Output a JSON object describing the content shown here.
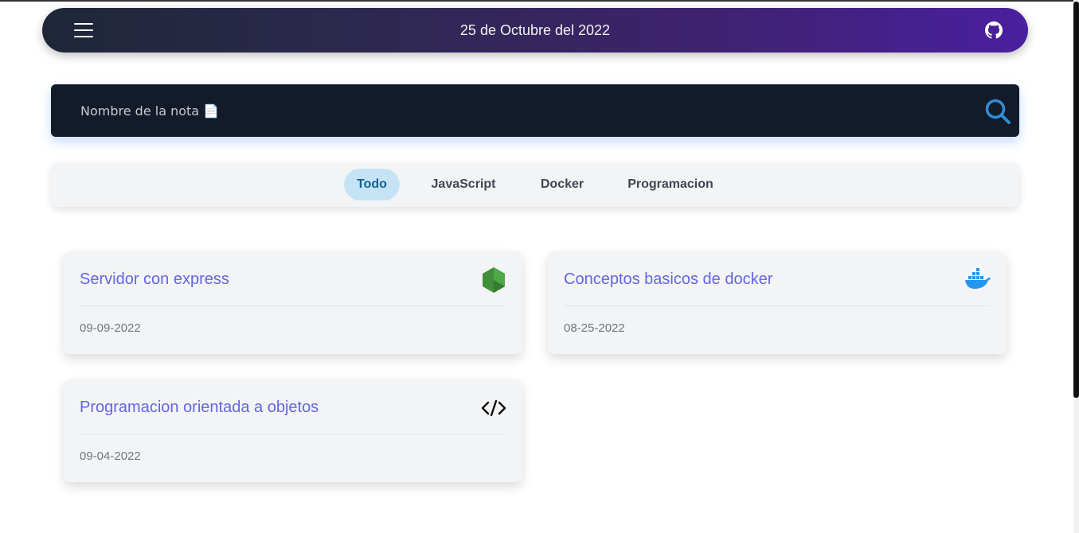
{
  "navbar": {
    "date": "25 de Octubre del 2022",
    "menu_icon": "hamburger-menu-icon",
    "github_icon": "github-icon",
    "gradient_colors": [
      "#1e2738",
      "#4b1fa0"
    ]
  },
  "search": {
    "placeholder": "Nombre de la nota 📄",
    "value": "",
    "icon": "search-icon",
    "icon_color": "#2e8fd8"
  },
  "filters": {
    "active": "Todo",
    "tabs": [
      {
        "label": "Todo"
      },
      {
        "label": "JavaScript"
      },
      {
        "label": "Docker"
      },
      {
        "label": "Programacion"
      }
    ]
  },
  "notes": [
    {
      "title": "Servidor con express",
      "date": "09-09-2022",
      "icon": "nodejs-icon"
    },
    {
      "title": "Conceptos basicos de docker",
      "date": "08-25-2022",
      "icon": "docker-icon"
    },
    {
      "title": "Programacion orientada a objetos",
      "date": "09-04-2022",
      "icon": "code-icon"
    }
  ],
  "colors": {
    "accent_title": "#6366e0",
    "active_tab_bg": "#c6e3f5",
    "active_tab_text": "#11608f"
  }
}
